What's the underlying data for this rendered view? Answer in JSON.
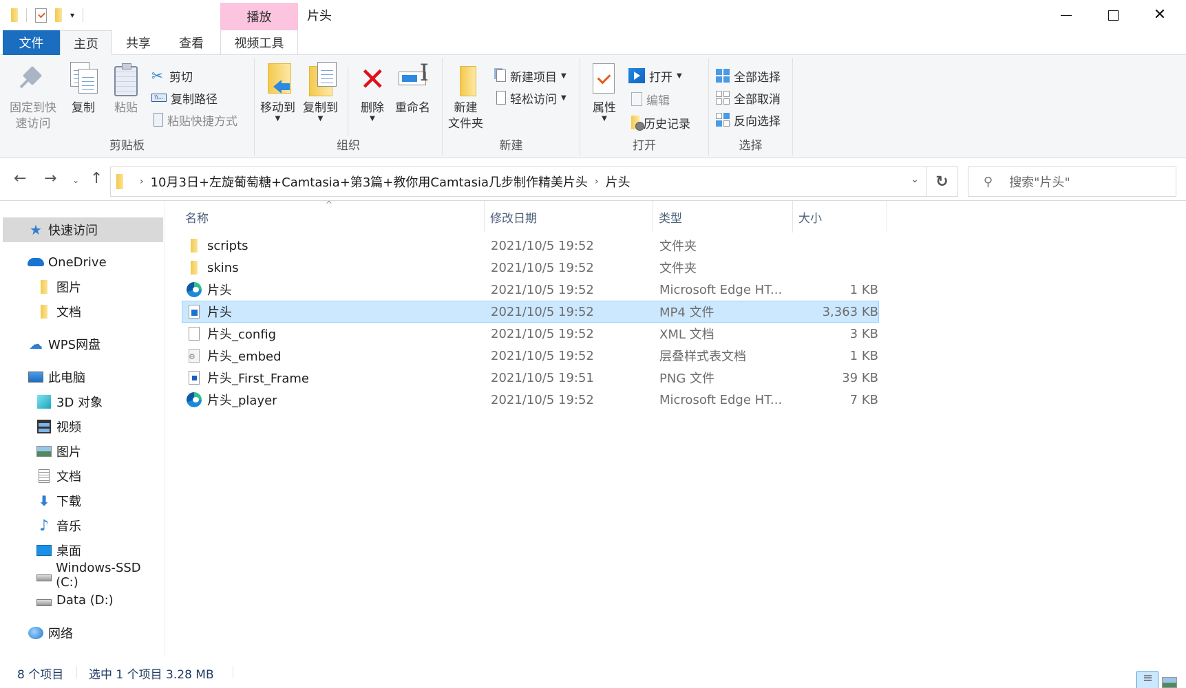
{
  "window": {
    "title": "片头",
    "contextual_tab_header": "播放",
    "controls": {
      "minimize": "—",
      "maximize": "☐",
      "close": "✕"
    }
  },
  "quick_access_toolbar": {
    "items": [
      "folder-icon",
      "properties-icon",
      "new-folder-icon"
    ],
    "dropdown": "▾"
  },
  "ribbon_tabs": [
    {
      "label": "文件",
      "active": false
    },
    {
      "label": "主页",
      "active": true
    },
    {
      "label": "共享",
      "active": false
    },
    {
      "label": "查看",
      "active": false
    },
    {
      "label": "视频工具",
      "active": false
    }
  ],
  "ribbon": {
    "collapse_icon": "︿",
    "help_icon": "?",
    "groups": {
      "clipboard": {
        "label": "剪贴板",
        "pin": "固定到快\n速访问",
        "pin_line1": "固定到快",
        "pin_line2": "速访问",
        "copy": "复制",
        "paste": "粘贴",
        "cut": "剪切",
        "copy_path": "复制路径",
        "paste_shortcut": "粘贴快捷方式"
      },
      "organize": {
        "label": "组织",
        "move_to": "移动到",
        "copy_to": "复制到",
        "delete": "删除",
        "rename": "重命名"
      },
      "new": {
        "label": "新建",
        "new_folder_line1": "新建",
        "new_folder_line2": "文件夹",
        "new_item": "新建项目",
        "easy_access": "轻松访问"
      },
      "open": {
        "label": "打开",
        "properties": "属性",
        "open": "打开",
        "edit": "编辑",
        "history": "历史记录"
      },
      "select": {
        "label": "选择",
        "select_all": "全部选择",
        "select_none": "全部取消",
        "invert_selection": "反向选择"
      }
    }
  },
  "navigation": {
    "back": "←",
    "forward": "→",
    "recent": "⌄",
    "up": "↑",
    "breadcrumb": [
      "10月3日+左旋葡萄糖+Camtasia+第3篇+教你用Camtasia几步制作精美片头",
      "片头"
    ],
    "refresh": "↻",
    "search_placeholder": "搜索\"片头\""
  },
  "sidebar": {
    "items": [
      {
        "label": "快速访问",
        "icon": "star-icon",
        "active": true
      },
      {
        "label": "OneDrive",
        "icon": "onedrive-cloud-icon"
      },
      {
        "label": "图片",
        "icon": "folder-icon"
      },
      {
        "label": "文档",
        "icon": "folder-icon"
      },
      {
        "label": "WPS网盘",
        "icon": "wps-cloud-icon"
      },
      {
        "label": "此电脑",
        "icon": "computer-icon"
      },
      {
        "label": "3D 对象",
        "icon": "3d-objects-icon"
      },
      {
        "label": "视频",
        "icon": "videos-icon"
      },
      {
        "label": "图片",
        "icon": "pictures-icon"
      },
      {
        "label": "文档",
        "icon": "documents-icon"
      },
      {
        "label": "下载",
        "icon": "downloads-icon"
      },
      {
        "label": "音乐",
        "icon": "music-icon"
      },
      {
        "label": "桌面",
        "icon": "desktop-icon"
      },
      {
        "label": "Windows-SSD (C:)",
        "icon": "drive-c-icon"
      },
      {
        "label": "Data (D:)",
        "icon": "drive-d-icon"
      },
      {
        "label": "网络",
        "icon": "network-icon"
      }
    ]
  },
  "file_list": {
    "columns": [
      "名称",
      "修改日期",
      "类型",
      "大小"
    ],
    "sort_indicator": "^",
    "rows": [
      {
        "name": "scripts",
        "date": "2021/10/5 19:52",
        "type": "文件夹",
        "size": "",
        "icon": "folder-icon",
        "selected": false
      },
      {
        "name": "skins",
        "date": "2021/10/5 19:52",
        "type": "文件夹",
        "size": "",
        "icon": "folder-icon",
        "selected": false
      },
      {
        "name": "片头",
        "date": "2021/10/5 19:52",
        "type": "Microsoft Edge HT...",
        "size": "1 KB",
        "icon": "edge-html-icon",
        "selected": false
      },
      {
        "name": "片头",
        "date": "2021/10/5 19:52",
        "type": "MP4 文件",
        "size": "3,363 KB",
        "icon": "mp4-file-icon",
        "selected": true
      },
      {
        "name": "片头_config",
        "date": "2021/10/5 19:52",
        "type": "XML 文档",
        "size": "3 KB",
        "icon": "xml-file-icon",
        "selected": false
      },
      {
        "name": "片头_embed",
        "date": "2021/10/5 19:52",
        "type": "层叠样式表文档",
        "size": "1 KB",
        "icon": "css-file-icon",
        "selected": false
      },
      {
        "name": "片头_First_Frame",
        "date": "2021/10/5 19:51",
        "type": "PNG 文件",
        "size": "39 KB",
        "icon": "png-file-icon",
        "selected": false
      },
      {
        "name": "片头_player",
        "date": "2021/10/5 19:52",
        "type": "Microsoft Edge HT...",
        "size": "7 KB",
        "icon": "edge-html-icon",
        "selected": false
      }
    ]
  },
  "status_bar": {
    "item_count": "8 个项目",
    "selection": "选中 1 个项目  3.28 MB",
    "view_modes": [
      "details-view-icon",
      "large-icons-view-icon"
    ]
  },
  "colors": {
    "accent": "#1a6dbf",
    "contextual_tab": "#fcc4df",
    "selection_bg": "#cce8ff",
    "selection_border": "#99d1ff",
    "ribbon_bg": "#f5f6f7"
  }
}
